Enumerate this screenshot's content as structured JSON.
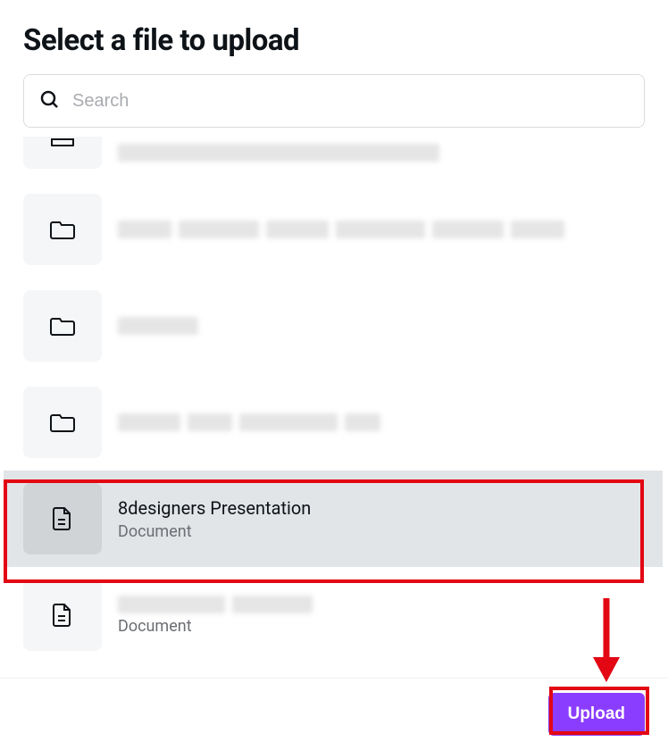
{
  "modal": {
    "title": "Select a file to upload"
  },
  "search": {
    "placeholder": "Search"
  },
  "items": [
    {
      "name": "",
      "type": "",
      "icon": "folder",
      "redacted": true,
      "partial": true
    },
    {
      "name": "",
      "type": "",
      "icon": "folder",
      "redacted": true
    },
    {
      "name": "",
      "type": "",
      "icon": "folder",
      "redacted": true
    },
    {
      "name": "",
      "type": "",
      "icon": "folder",
      "redacted": true
    },
    {
      "name": "8designers Presentation",
      "type": "Document",
      "icon": "document",
      "redacted": false,
      "selected": true
    },
    {
      "name": "",
      "type": "Document",
      "icon": "document",
      "redacted": true
    }
  ],
  "footer": {
    "upload_label": "Upload"
  }
}
